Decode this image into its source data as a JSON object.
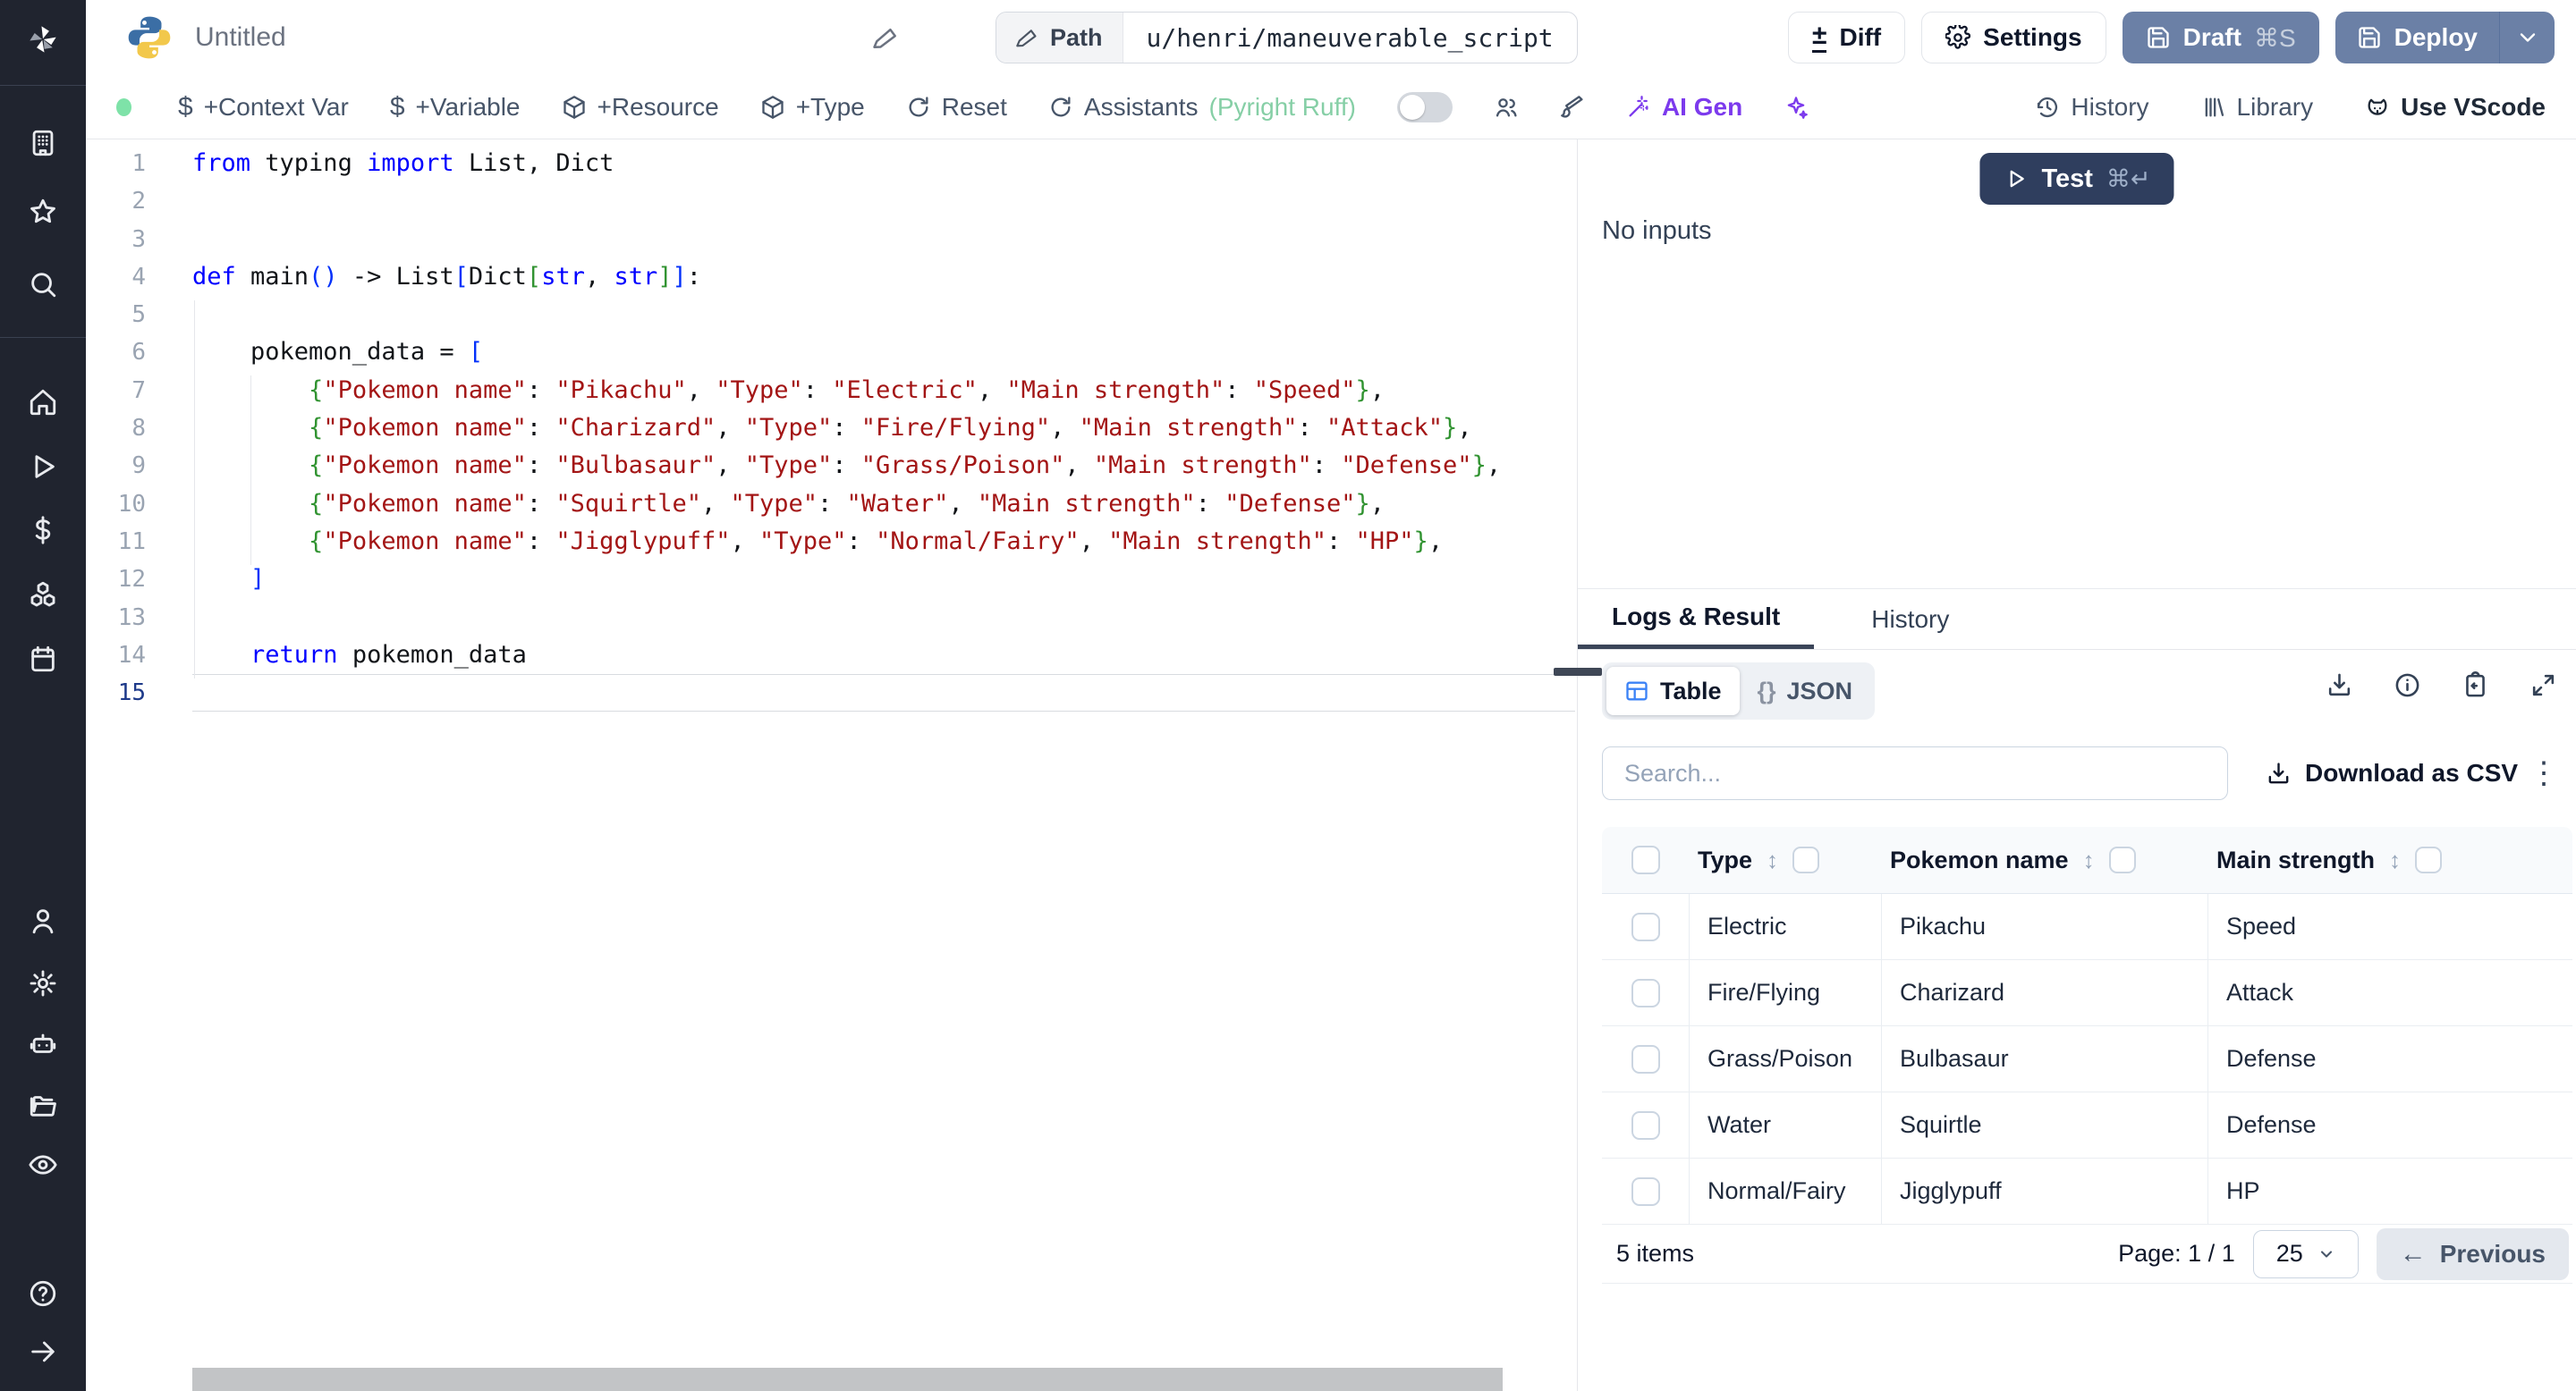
{
  "colors": {
    "accent_blue": "#3b82f6",
    "button_slate": "#6b80a6",
    "test_navy": "#2f3e5e",
    "ai_purple": "#7c3aed",
    "assistant_green": "#86cfa6",
    "status_green": "#7ee2a8",
    "keyword_blue": "#0000ff",
    "string_red": "#a31515",
    "bracket_blue": "#0431fa",
    "bracket_green": "#319331"
  },
  "sidebar": {
    "icons": [
      "windmill-logo",
      "building",
      "star",
      "search",
      "home",
      "play",
      "dollar",
      "boxes",
      "calendar",
      "user",
      "gear",
      "robot",
      "folder",
      "eye",
      "help",
      "arrow-right"
    ]
  },
  "header": {
    "title": "Untitled",
    "path": {
      "label": "Path",
      "value": "u/henri/maneuverable_script"
    },
    "diff": "Diff",
    "settings": "Settings",
    "draft": "Draft",
    "draft_shortcut": "⌘S",
    "deploy": "Deploy"
  },
  "toolbar": {
    "context_var": "+Context Var",
    "variable": "+Variable",
    "resource": "+Resource",
    "type": "+Type",
    "reset": "Reset",
    "assistants": "Assistants",
    "assistants_detail": "(Pyright Ruff)",
    "ai_gen": "AI Gen",
    "history": "History",
    "library": "Library",
    "vscode": "Use VScode"
  },
  "editor": {
    "lines": [
      {
        "n": 1,
        "tokens": [
          [
            "k",
            "from"
          ],
          [
            "p",
            " typing "
          ],
          [
            "k",
            "import"
          ],
          [
            "p",
            " List, Dict"
          ]
        ]
      },
      {
        "n": 2,
        "tokens": []
      },
      {
        "n": 3,
        "tokens": []
      },
      {
        "n": 4,
        "tokens": [
          [
            "k",
            "def"
          ],
          [
            "p",
            " main"
          ],
          [
            "b",
            "()"
          ],
          [
            "p",
            " -> List"
          ],
          [
            "b",
            "["
          ],
          [
            "p",
            "Dict"
          ],
          [
            "g",
            "["
          ],
          [
            "k",
            "str"
          ],
          [
            "p",
            ", "
          ],
          [
            "k",
            "str"
          ],
          [
            "g",
            "]"
          ],
          [
            "b",
            "]"
          ],
          [
            "p",
            ":"
          ]
        ]
      },
      {
        "n": 5,
        "tokens": []
      },
      {
        "n": 6,
        "tokens": [
          [
            "p",
            "    pokemon_data = "
          ],
          [
            "b",
            "["
          ]
        ]
      },
      {
        "n": 7,
        "tokens": [
          [
            "p",
            "        "
          ],
          [
            "g",
            "{"
          ],
          [
            "s",
            "\"Pokemon name\""
          ],
          [
            "p",
            ": "
          ],
          [
            "s",
            "\"Pikachu\""
          ],
          [
            "p",
            ", "
          ],
          [
            "s",
            "\"Type\""
          ],
          [
            "p",
            ": "
          ],
          [
            "s",
            "\"Electric\""
          ],
          [
            "p",
            ", "
          ],
          [
            "s",
            "\"Main strength\""
          ],
          [
            "p",
            ": "
          ],
          [
            "s",
            "\"Speed\""
          ],
          [
            "g",
            "}"
          ],
          [
            "p",
            ","
          ]
        ]
      },
      {
        "n": 8,
        "tokens": [
          [
            "p",
            "        "
          ],
          [
            "g",
            "{"
          ],
          [
            "s",
            "\"Pokemon name\""
          ],
          [
            "p",
            ": "
          ],
          [
            "s",
            "\"Charizard\""
          ],
          [
            "p",
            ", "
          ],
          [
            "s",
            "\"Type\""
          ],
          [
            "p",
            ": "
          ],
          [
            "s",
            "\"Fire/Flying\""
          ],
          [
            "p",
            ", "
          ],
          [
            "s",
            "\"Main strength\""
          ],
          [
            "p",
            ": "
          ],
          [
            "s",
            "\"Attack\""
          ],
          [
            "g",
            "}"
          ],
          [
            "p",
            ","
          ]
        ]
      },
      {
        "n": 9,
        "tokens": [
          [
            "p",
            "        "
          ],
          [
            "g",
            "{"
          ],
          [
            "s",
            "\"Pokemon name\""
          ],
          [
            "p",
            ": "
          ],
          [
            "s",
            "\"Bulbasaur\""
          ],
          [
            "p",
            ", "
          ],
          [
            "s",
            "\"Type\""
          ],
          [
            "p",
            ": "
          ],
          [
            "s",
            "\"Grass/Poison\""
          ],
          [
            "p",
            ", "
          ],
          [
            "s",
            "\"Main strength\""
          ],
          [
            "p",
            ": "
          ],
          [
            "s",
            "\"Defense\""
          ],
          [
            "g",
            "}"
          ],
          [
            "p",
            ","
          ]
        ]
      },
      {
        "n": 10,
        "tokens": [
          [
            "p",
            "        "
          ],
          [
            "g",
            "{"
          ],
          [
            "s",
            "\"Pokemon name\""
          ],
          [
            "p",
            ": "
          ],
          [
            "s",
            "\"Squirtle\""
          ],
          [
            "p",
            ", "
          ],
          [
            "s",
            "\"Type\""
          ],
          [
            "p",
            ": "
          ],
          [
            "s",
            "\"Water\""
          ],
          [
            "p",
            ", "
          ],
          [
            "s",
            "\"Main strength\""
          ],
          [
            "p",
            ": "
          ],
          [
            "s",
            "\"Defense\""
          ],
          [
            "g",
            "}"
          ],
          [
            "p",
            ","
          ]
        ]
      },
      {
        "n": 11,
        "tokens": [
          [
            "p",
            "        "
          ],
          [
            "g",
            "{"
          ],
          [
            "s",
            "\"Pokemon name\""
          ],
          [
            "p",
            ": "
          ],
          [
            "s",
            "\"Jigglypuff\""
          ],
          [
            "p",
            ", "
          ],
          [
            "s",
            "\"Type\""
          ],
          [
            "p",
            ": "
          ],
          [
            "s",
            "\"Normal/Fairy\""
          ],
          [
            "p",
            ", "
          ],
          [
            "s",
            "\"Main strength\""
          ],
          [
            "p",
            ": "
          ],
          [
            "s",
            "\"HP\""
          ],
          [
            "g",
            "}"
          ],
          [
            "p",
            ","
          ]
        ]
      },
      {
        "n": 12,
        "tokens": [
          [
            "p",
            "    "
          ],
          [
            "b",
            "]"
          ]
        ]
      },
      {
        "n": 13,
        "tokens": []
      },
      {
        "n": 14,
        "tokens": [
          [
            "p",
            "    "
          ],
          [
            "k",
            "return"
          ],
          [
            "p",
            " pokemon_data"
          ]
        ]
      },
      {
        "n": 15,
        "tokens": [],
        "current": true
      }
    ]
  },
  "right_panel": {
    "test": {
      "label": "Test",
      "shortcut": "⌘↵"
    },
    "no_inputs": "No inputs",
    "tabs": {
      "logs": "Logs & Result",
      "history": "History"
    },
    "view": {
      "table": "Table",
      "json": "JSON",
      "json_icon": "{}"
    },
    "search_placeholder": "Search...",
    "download_csv": "Download as CSV",
    "table": {
      "columns": [
        "Type",
        "Pokemon name",
        "Main strength"
      ],
      "rows": [
        [
          "Electric",
          "Pikachu",
          "Speed"
        ],
        [
          "Fire/Flying",
          "Charizard",
          "Attack"
        ],
        [
          "Grass/Poison",
          "Bulbasaur",
          "Defense"
        ],
        [
          "Water",
          "Squirtle",
          "Defense"
        ],
        [
          "Normal/Fairy",
          "Jigglypuff",
          "HP"
        ]
      ]
    },
    "footer": {
      "items": "5 items",
      "page": "Page: 1 / 1",
      "page_size": "25",
      "previous": "Previous"
    }
  }
}
